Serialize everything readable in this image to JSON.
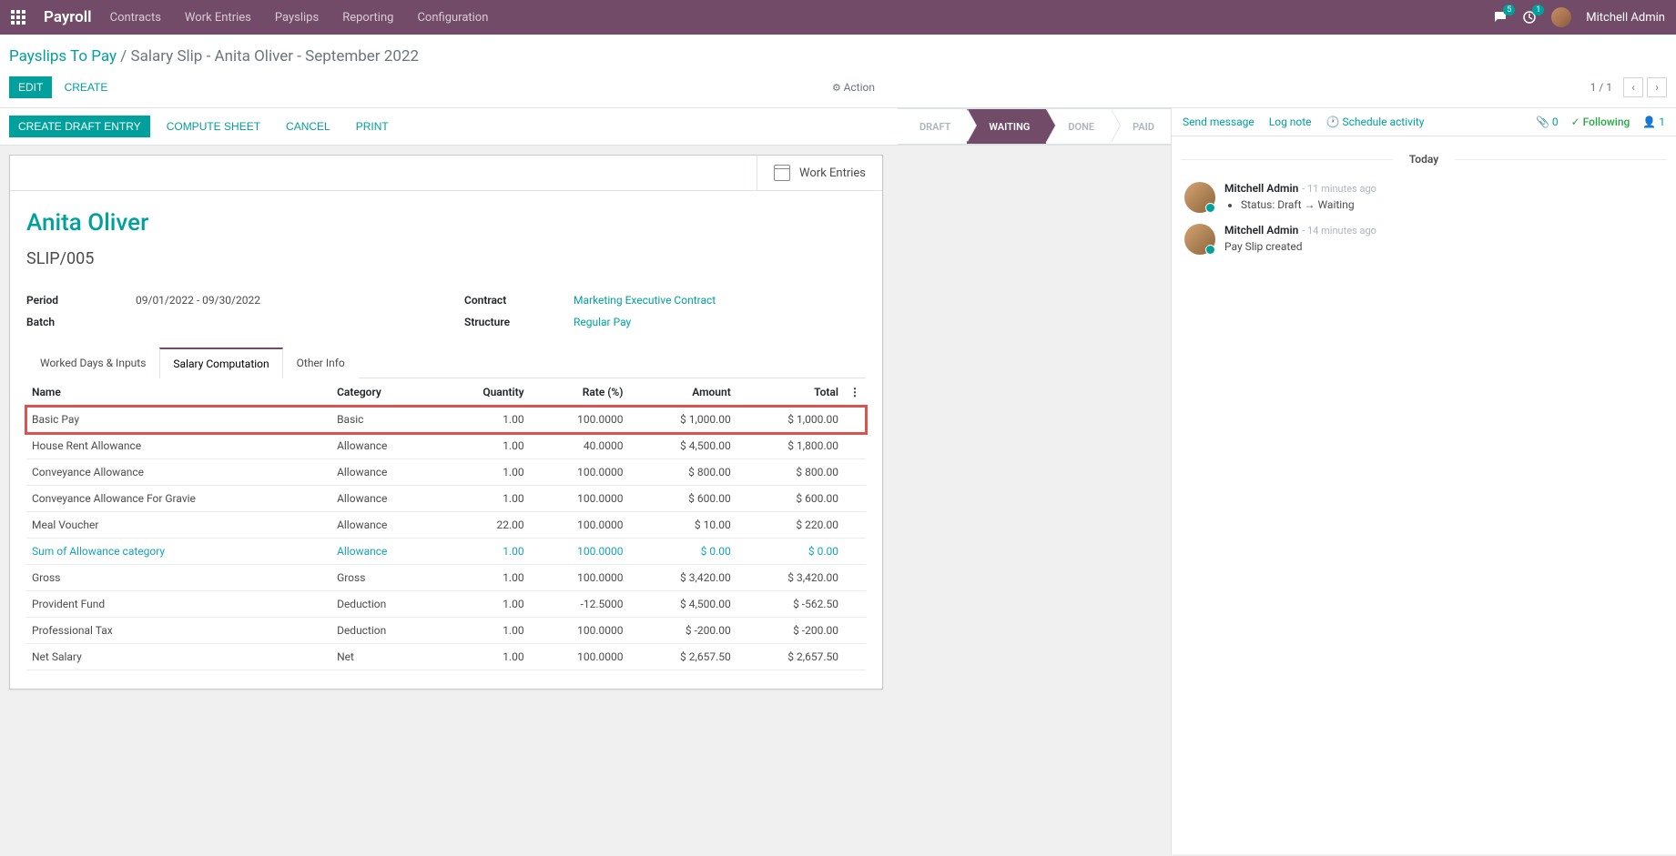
{
  "navbar": {
    "brand": "Payroll",
    "menu": [
      "Contracts",
      "Work Entries",
      "Payslips",
      "Reporting",
      "Configuration"
    ],
    "discuss_badge": "5",
    "activity_badge": "1",
    "user_name": "Mitchell Admin"
  },
  "breadcrumb": {
    "parent": "Payslips To Pay",
    "current": "Salary Slip - Anita Oliver - September 2022"
  },
  "toolbar": {
    "edit": "EDIT",
    "create": "CREATE",
    "action": "Action",
    "pager": "1 / 1"
  },
  "statusbar": {
    "create_draft_entry": "CREATE DRAFT ENTRY",
    "compute_sheet": "COMPUTE SHEET",
    "cancel": "CANCEL",
    "print": "PRINT",
    "steps": [
      "DRAFT",
      "WAITING",
      "DONE",
      "PAID"
    ],
    "active_step": 1
  },
  "sheet": {
    "work_entries": "Work Entries",
    "employee": "Anita Oliver",
    "reference": "SLIP/005",
    "fields": {
      "period_label": "Period",
      "period_value": "09/01/2022 - 09/30/2022",
      "batch_label": "Batch",
      "batch_value": "",
      "contract_label": "Contract",
      "contract_value": "Marketing Executive Contract",
      "structure_label": "Structure",
      "structure_value": "Regular Pay"
    },
    "tabs": [
      "Worked Days & Inputs",
      "Salary Computation",
      "Other Info"
    ],
    "active_tab": 1,
    "table": {
      "headers": [
        "Name",
        "Category",
        "Quantity",
        "Rate (%)",
        "Amount",
        "Total"
      ],
      "rows": [
        {
          "name": "Basic Pay",
          "category": "Basic",
          "qty": "1.00",
          "rate": "100.0000",
          "amount": "$ 1,000.00",
          "total": "$ 1,000.00",
          "highlighted": true
        },
        {
          "name": "House Rent Allowance",
          "category": "Allowance",
          "qty": "1.00",
          "rate": "40.0000",
          "amount": "$ 4,500.00",
          "total": "$ 1,800.00"
        },
        {
          "name": "Conveyance Allowance",
          "category": "Allowance",
          "qty": "1.00",
          "rate": "100.0000",
          "amount": "$ 800.00",
          "total": "$ 800.00"
        },
        {
          "name": "Conveyance Allowance For Gravie",
          "category": "Allowance",
          "qty": "1.00",
          "rate": "100.0000",
          "amount": "$ 600.00",
          "total": "$ 600.00"
        },
        {
          "name": "Meal Voucher",
          "category": "Allowance",
          "qty": "22.00",
          "rate": "100.0000",
          "amount": "$ 10.00",
          "total": "$ 220.00"
        },
        {
          "name": "Sum of Allowance category",
          "category": "Allowance",
          "qty": "1.00",
          "rate": "100.0000",
          "amount": "$ 0.00",
          "total": "$ 0.00",
          "link": true
        },
        {
          "name": "Gross",
          "category": "Gross",
          "qty": "1.00",
          "rate": "100.0000",
          "amount": "$ 3,420.00",
          "total": "$ 3,420.00"
        },
        {
          "name": "Provident Fund",
          "category": "Deduction",
          "qty": "1.00",
          "rate": "-12.5000",
          "amount": "$ 4,500.00",
          "total": "$ -562.50"
        },
        {
          "name": "Professional Tax",
          "category": "Deduction",
          "qty": "1.00",
          "rate": "100.0000",
          "amount": "$ -200.00",
          "total": "$ -200.00"
        },
        {
          "name": "Net Salary",
          "category": "Net",
          "qty": "1.00",
          "rate": "100.0000",
          "amount": "$ 2,657.50",
          "total": "$ 2,657.50"
        }
      ]
    }
  },
  "chatter": {
    "send_message": "Send message",
    "log_note": "Log note",
    "schedule_activity": "Schedule activity",
    "attach_count": "0",
    "following": "Following",
    "followers_count": "1",
    "date_label": "Today",
    "messages": [
      {
        "author": "Mitchell Admin",
        "time": "- 11 minutes ago",
        "body_type": "status",
        "body_label": "Status:",
        "from": "Draft",
        "to": "Waiting"
      },
      {
        "author": "Mitchell Admin",
        "time": "- 14 minutes ago",
        "body_type": "text",
        "body": "Pay Slip created"
      }
    ]
  }
}
